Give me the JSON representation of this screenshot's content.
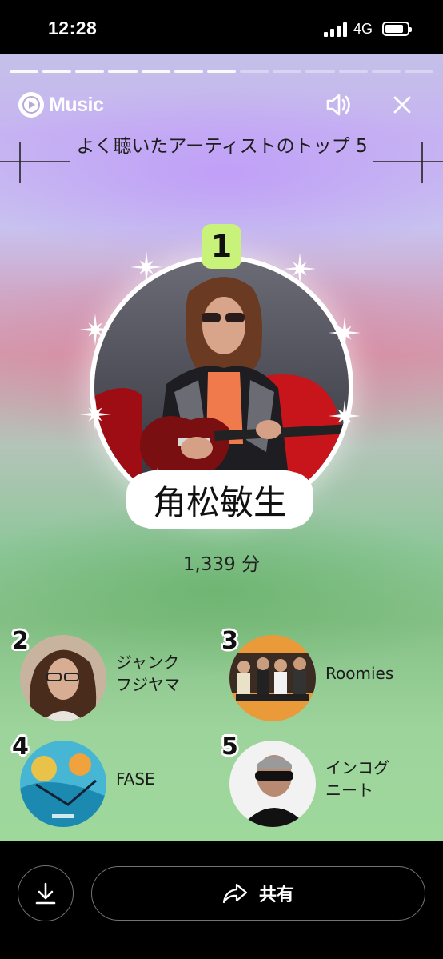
{
  "status_bar": {
    "time": "12:28",
    "network": "4G"
  },
  "story": {
    "progress_segments": 13,
    "progress_completed": 7,
    "app_name": "Music",
    "heading": "よく聴いたアーティストのトップ 5",
    "top_artist": {
      "rank": "1",
      "name": "角松敏生",
      "minutes": "1,339 分"
    },
    "others": [
      {
        "rank": "2",
        "name": "ジャンク\nフジヤマ"
      },
      {
        "rank": "3",
        "name": "Roomies"
      },
      {
        "rank": "4",
        "name": "FASE"
      },
      {
        "rank": "5",
        "name": "インコグ\nニート"
      }
    ]
  },
  "actions": {
    "share_label": "共有"
  },
  "colors": {
    "rank_badge": "#c9f27a",
    "bg_top": "#c7b4f2",
    "bg_bottom": "#9ed89b"
  }
}
